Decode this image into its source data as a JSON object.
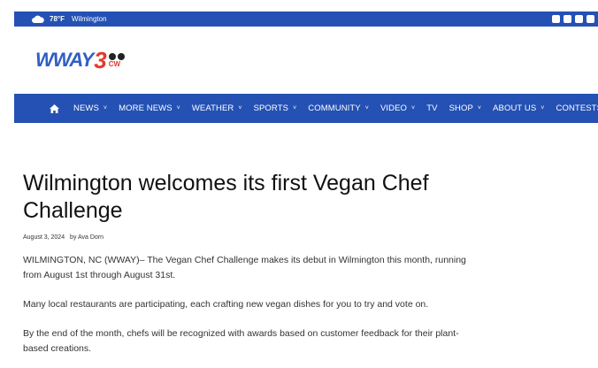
{
  "topbar": {
    "weather_icon": "cloud-icon",
    "temperature": "78°F",
    "city": "Wilmington",
    "social_icons": [
      "facebook-icon",
      "twitter-icon",
      "youtube-icon",
      "instagram-icon"
    ]
  },
  "logo": {
    "wordmark": "WWAY",
    "number": "3",
    "cw": "CW"
  },
  "nav": {
    "home_icon": "home-icon",
    "items": [
      {
        "label": "NEWS",
        "has_dropdown": true
      },
      {
        "label": "MORE NEWS",
        "has_dropdown": true
      },
      {
        "label": "WEATHER",
        "has_dropdown": true
      },
      {
        "label": "SPORTS",
        "has_dropdown": true
      },
      {
        "label": "COMMUNITY",
        "has_dropdown": true
      },
      {
        "label": "VIDEO",
        "has_dropdown": true
      },
      {
        "label": "TV",
        "has_dropdown": false
      },
      {
        "label": "SHOP",
        "has_dropdown": true
      },
      {
        "label": "ABOUT US",
        "has_dropdown": true
      },
      {
        "label": "CONTESTS",
        "has_dropdown": false
      }
    ],
    "chevron": "˅"
  },
  "article": {
    "headline": "Wilmington welcomes its first Vegan Chef Challenge",
    "date": "August 3, 2024",
    "author": "by Ava Dorn",
    "paragraphs": [
      "WILMINGTON, NC (WWAY)– The Vegan Chef Challenge makes its debut in Wilmington this month, running from August 1st through August 31st.",
      "Many local restaurants are participating, each crafting new vegan dishes for you to try and vote on.",
      "By the end of the month, chefs will be recognized with awards based on customer feedback for their plant-based creations."
    ]
  },
  "colors": {
    "brand_blue": "#2451b3",
    "logo_red": "#e23a2c"
  }
}
